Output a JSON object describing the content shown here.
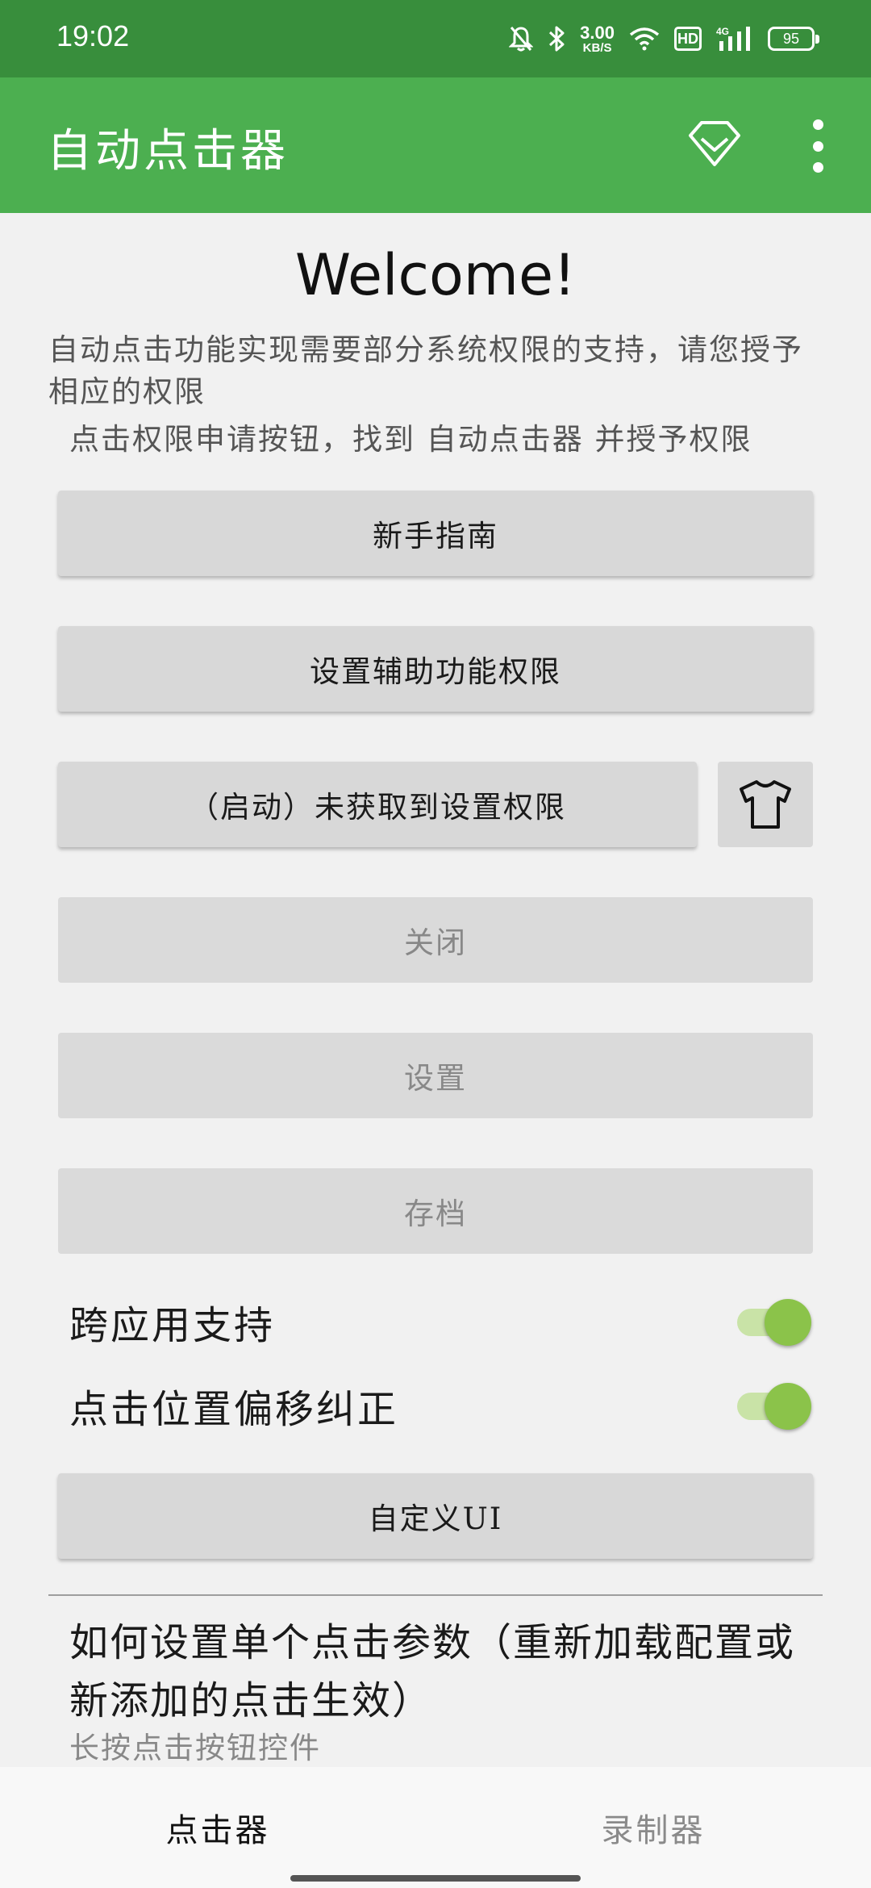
{
  "status_bar": {
    "time": "19:02",
    "net_speed_value": "3.00",
    "net_speed_unit": "KB/S",
    "hd_label": "HD",
    "signal_label": "4G",
    "battery": "95",
    "icons": [
      "mute-bell-icon",
      "bluetooth-icon",
      "wifi-icon",
      "signal-icon",
      "battery-icon"
    ]
  },
  "appbar": {
    "title": "自动点击器",
    "icons": [
      "diamond-icon",
      "more-vert-icon"
    ]
  },
  "main": {
    "welcome": "Welcome!",
    "description": "自动点击功能实现需要部分系统权限的支持，请您授予相应的权限",
    "hint": "点击权限申请按钮，找到 自动点击器 并授予权限",
    "buttons": {
      "guide": "新手指南",
      "accessibility": "设置辅助功能权限",
      "start": "（启动）未获取到设置权限",
      "close": "关闭",
      "settings": "设置",
      "archive": "存档",
      "custom_ui": "自定义UI"
    },
    "switches": {
      "cross_app": {
        "label": "跨应用支持",
        "on": true
      },
      "offset_fix": {
        "label": "点击位置偏移纠正",
        "on": true
      }
    },
    "faq": {
      "title": "如何设置单个点击参数（重新加载配置或新添加的点击生效）",
      "subtitle": "长按点击按钮控件"
    }
  },
  "bottom_nav": {
    "tabs": [
      {
        "label": "点击器",
        "active": true
      },
      {
        "label": "录制器",
        "active": false
      }
    ]
  },
  "colors": {
    "status_bar": "#388e3c",
    "app_bar": "#4caf50",
    "switch_thumb": "#8bc34a",
    "switch_track": "#c9e3a7",
    "button": "#d8d8d8"
  }
}
